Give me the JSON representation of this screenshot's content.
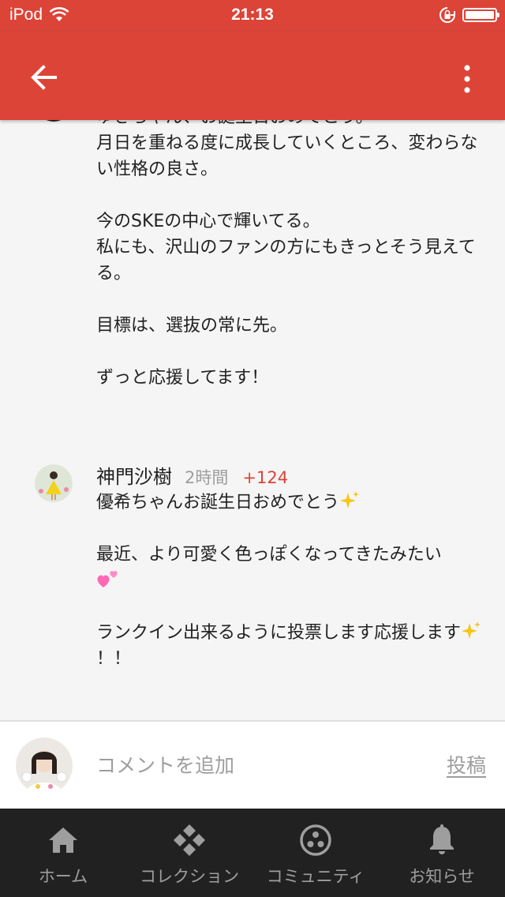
{
  "status_bar": {
    "carrier": "iPod",
    "time": "21:13"
  },
  "colors": {
    "brand": "#db4437",
    "score": "#db4437",
    "nav_background": "#212121"
  },
  "comments": [
    {
      "text": "ゆきちゃん、お誕生日おめでとう。\n月日を重ねる度に成長していくところ、変わらない性格の良さ。\n\n今のSKEの中心で輝いてる。\n私にも、沢山のファンの方にもきっとそう見えてる。\n\n目標は、選抜の常に先。\n\nずっと応援してます！"
    },
    {
      "author": "神門沙樹",
      "time": "2時間",
      "score": "+124",
      "text_1": "優希ちゃんお誕生日おめでとう",
      "text_2": "\n\n最近、より可愛く色っぽくなってきたみたい",
      "text_3": "\n\nランクイン出来るように投票します応援します",
      "text_4": "！！"
    }
  ],
  "composer": {
    "placeholder": "コメントを追加",
    "post_label": "投稿"
  },
  "bottom_nav": [
    {
      "label": "ホーム",
      "icon": "home-icon"
    },
    {
      "label": "コレクション",
      "icon": "collection-icon"
    },
    {
      "label": "コミュニティ",
      "icon": "community-icon"
    },
    {
      "label": "お知らせ",
      "icon": "bell-icon"
    }
  ]
}
